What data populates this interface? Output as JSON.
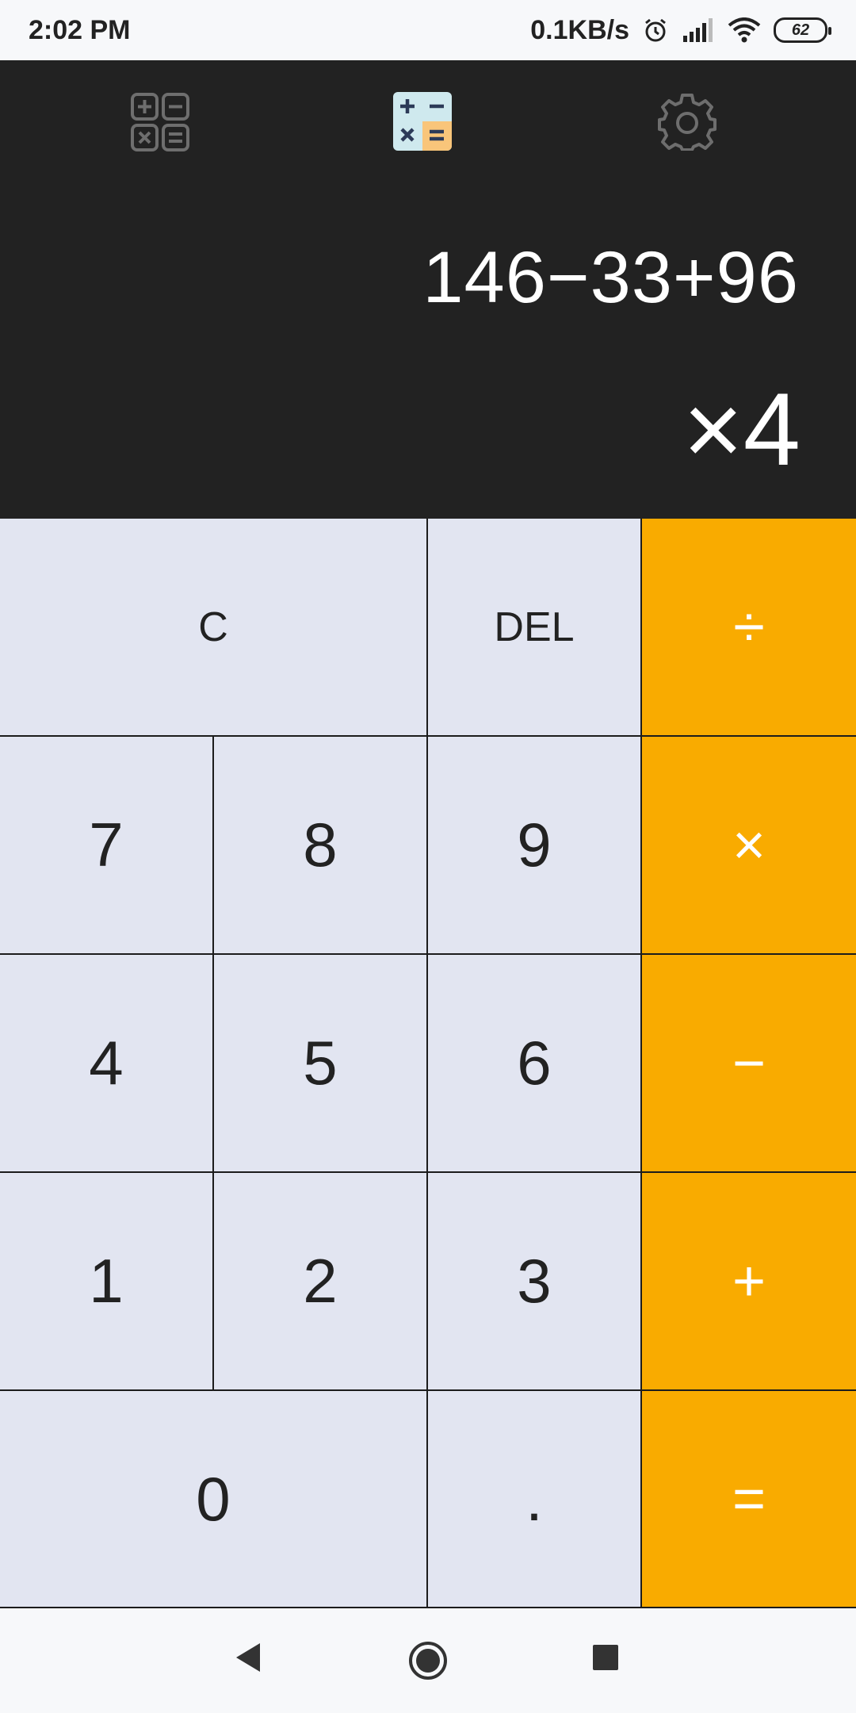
{
  "status_bar": {
    "time": "2:02 PM",
    "network_speed": "0.1KB/s",
    "battery_level": "62",
    "icons": [
      "alarm-icon",
      "signal-icon",
      "wifi-icon",
      "battery-icon"
    ]
  },
  "toolbar": {
    "icons": [
      "converter-grid-icon",
      "calculator-app-icon",
      "settings-gear-icon"
    ]
  },
  "display": {
    "expression": "146−33+96",
    "result": "×4"
  },
  "keypad": {
    "clear": "C",
    "delete": "DEL",
    "divide": "÷",
    "seven": "7",
    "eight": "8",
    "nine": "9",
    "multiply": "×",
    "four": "4",
    "five": "5",
    "six": "6",
    "minus": "−",
    "one": "1",
    "two": "2",
    "three": "3",
    "plus": "+",
    "zero": "0",
    "decimal": ".",
    "equals": "="
  },
  "colors": {
    "display_bg": "#222222",
    "key_bg": "#e2e5f1",
    "operator_bg": "#f9ab00",
    "operator_text": "#ffffff"
  },
  "nav_bar": {
    "icons": [
      "back-icon",
      "home-icon",
      "recents-icon"
    ]
  }
}
